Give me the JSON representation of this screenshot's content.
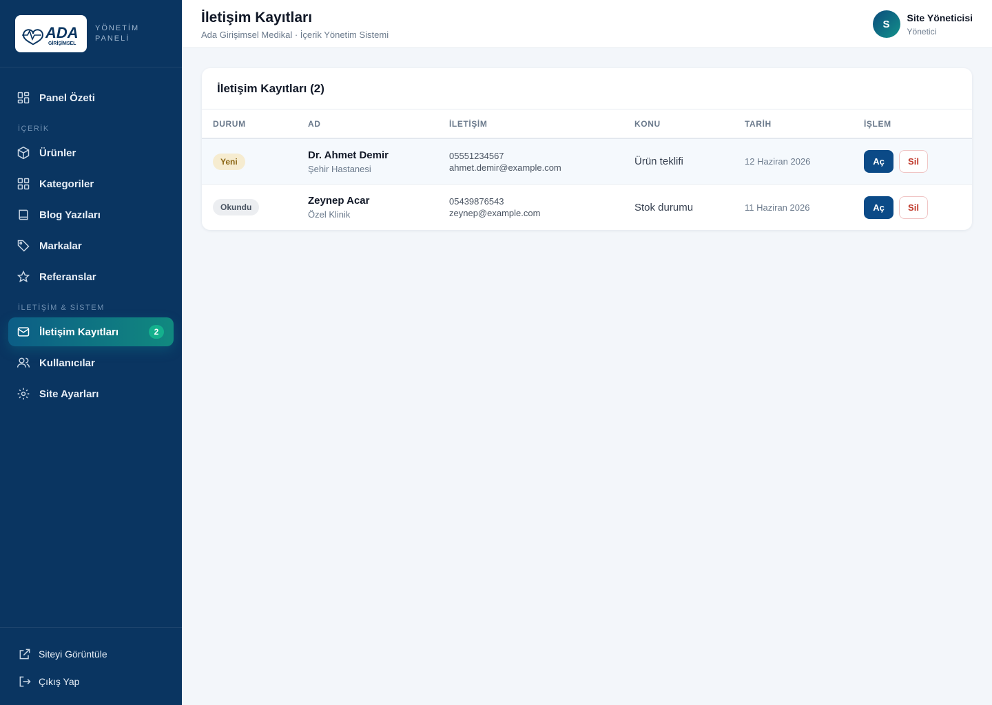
{
  "brand": {
    "logo_text": "ADA",
    "logo_sub": "GİRİŞİMSEL",
    "panel_line1": "YÖNETİM",
    "panel_line2": "PANELİ"
  },
  "sidebar": {
    "items": [
      {
        "label": "Panel Özeti",
        "icon": "dashboard-icon"
      },
      {
        "label": "Ürünler",
        "icon": "box-icon"
      },
      {
        "label": "Kategoriler",
        "icon": "grid-icon"
      },
      {
        "label": "Blog Yazıları",
        "icon": "book-icon"
      },
      {
        "label": "Markalar",
        "icon": "tag-icon"
      },
      {
        "label": "Referanslar",
        "icon": "star-icon"
      },
      {
        "label": "İletişim Kayıtları",
        "icon": "mail-icon",
        "badge": "2",
        "active": true
      },
      {
        "label": "Kullanıcılar",
        "icon": "users-icon"
      },
      {
        "label": "Site Ayarları",
        "icon": "gear-icon"
      }
    ],
    "sections": {
      "content": "İÇERİK",
      "system": "İLETİŞİM & SİSTEM"
    },
    "footer": [
      {
        "label": "Siteyi Görüntüle",
        "icon": "external-link-icon"
      },
      {
        "label": "Çıkış Yap",
        "icon": "logout-icon"
      }
    ]
  },
  "header": {
    "title": "İletişim Kayıtları",
    "subtitle": "Ada Girişimsel Medikal · İçerik Yönetim Sistemi",
    "user": {
      "initial": "S",
      "name": "Site Yöneticisi",
      "role": "Yönetici"
    }
  },
  "card": {
    "title": "İletişim Kayıtları (2)",
    "columns": [
      "DURUM",
      "AD",
      "İLETİŞİM",
      "KONU",
      "TARİH",
      "İŞLEM"
    ],
    "rows": [
      {
        "status": "Yeni",
        "name": "Dr. Ahmet Demir",
        "org": "Şehir Hastanesi",
        "phone": "05551234567",
        "email": "ahmet.demir@example.com",
        "subject": "Ürün teklifi",
        "date": "12 Haziran 2026",
        "open": "Aç",
        "delete": "Sil"
      },
      {
        "status": "Okundu",
        "name": "Zeynep Acar",
        "org": "Özel Klinik",
        "phone": "05439876543",
        "email": "zeynep@example.com",
        "subject": "Stok durumu",
        "date": "11 Haziran 2026",
        "open": "Aç",
        "delete": "Sil"
      }
    ]
  },
  "colors": {
    "sidebar": "#0a3561",
    "accent": "#11897f",
    "primary_button": "#0b4a87",
    "danger": "#c0392b",
    "badge_new_bg": "#f6ecd0"
  }
}
